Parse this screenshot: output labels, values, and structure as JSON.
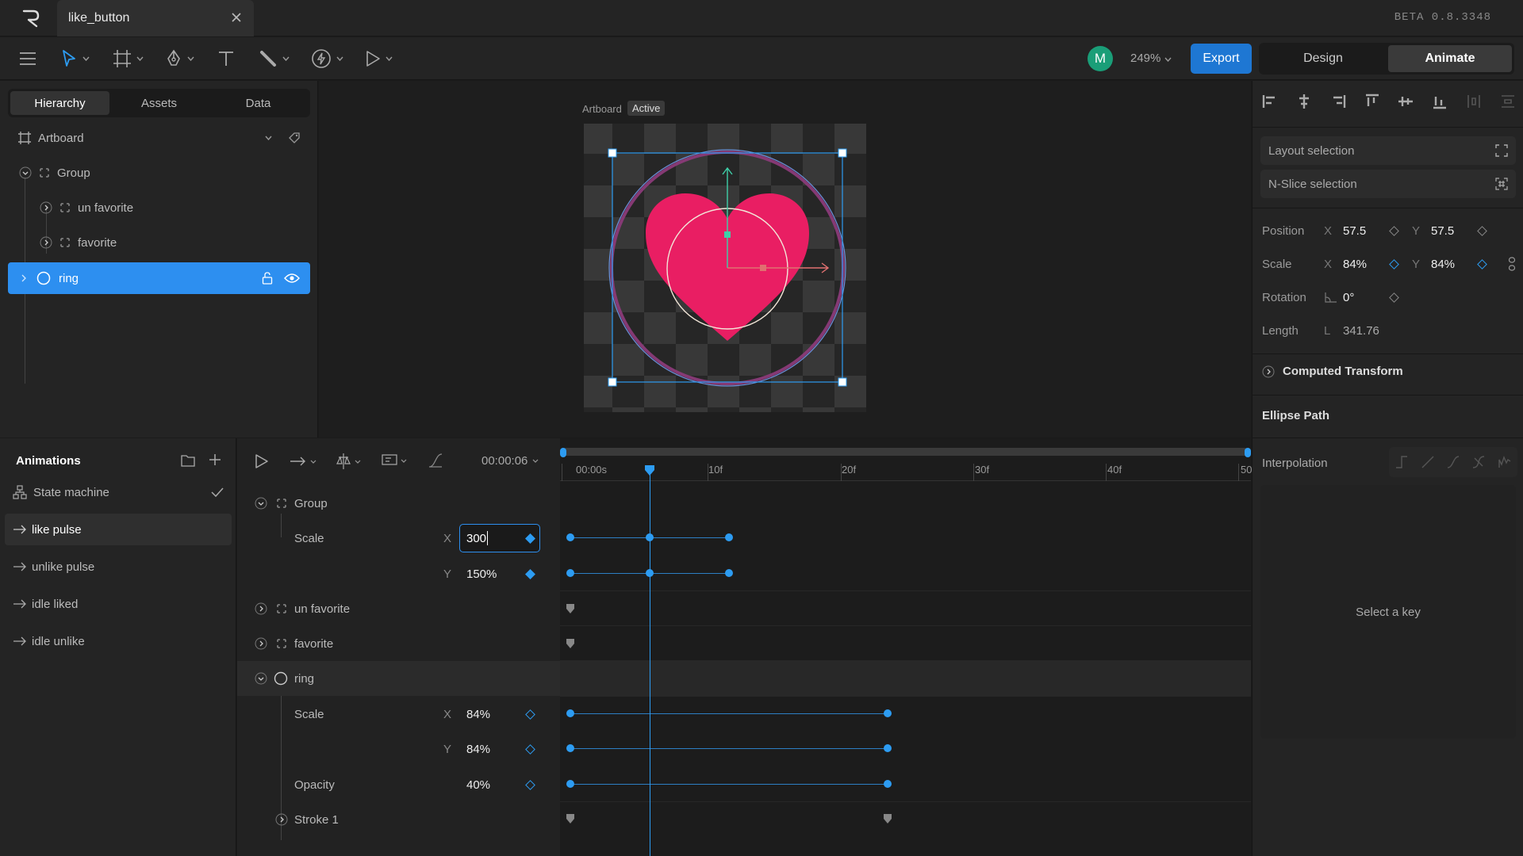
{
  "app": {
    "tab_title": "like_button",
    "version": "BETA 0.8.3348"
  },
  "toolbar": {
    "avatar_initial": "M",
    "zoom": "249%",
    "export_label": "Export",
    "modes": [
      "Design",
      "Animate"
    ],
    "active_mode": "Animate"
  },
  "left_panel": {
    "tabs": [
      "Hierarchy",
      "Assets",
      "Data"
    ],
    "active_tab": "Hierarchy",
    "tree": [
      {
        "label": "Artboard"
      },
      {
        "label": "Group"
      },
      {
        "label": "un favorite"
      },
      {
        "label": "favorite"
      },
      {
        "label": "ring",
        "selected": true
      }
    ]
  },
  "canvas": {
    "artboard_label": "Artboard",
    "artboard_badge": "Active",
    "heart_color": "#e91e63",
    "ring_color": "#8a3a78"
  },
  "animations": {
    "title": "Animations",
    "state_machine": "State machine",
    "items": [
      "like pulse",
      "unlike pulse",
      "idle liked",
      "idle unlike"
    ],
    "active": "like pulse"
  },
  "timeline": {
    "time": "00:00:06",
    "ruler": [
      "00:00s",
      "10f",
      "20f",
      "30f",
      "40f",
      "50"
    ],
    "rows": {
      "group": "Group",
      "group_scale": "Scale",
      "group_scale_x": "300",
      "group_scale_y": "150%",
      "unfavorite": "un favorite",
      "favorite": "favorite",
      "ring": "ring",
      "ring_scale": "Scale",
      "ring_scale_x": "84%",
      "ring_scale_y": "84%",
      "ring_opacity": "Opacity",
      "ring_opacity_val": "40%",
      "stroke": "Stroke 1"
    },
    "axis_x": "X",
    "axis_y": "Y"
  },
  "properties": {
    "layout_selection": "Layout selection",
    "nslice_selection": "N-Slice selection",
    "position_label": "Position",
    "position_x": "57.5",
    "position_y": "57.5",
    "scale_label": "Scale",
    "scale_x": "84%",
    "scale_y": "84%",
    "rotation_label": "Rotation",
    "rotation": "0°",
    "length_label": "Length",
    "length_axis": "L",
    "length": "341.76",
    "computed_transform": "Computed Transform",
    "ellipse_path": "Ellipse Path",
    "interpolation": "Interpolation",
    "select_key": "Select a key"
  }
}
